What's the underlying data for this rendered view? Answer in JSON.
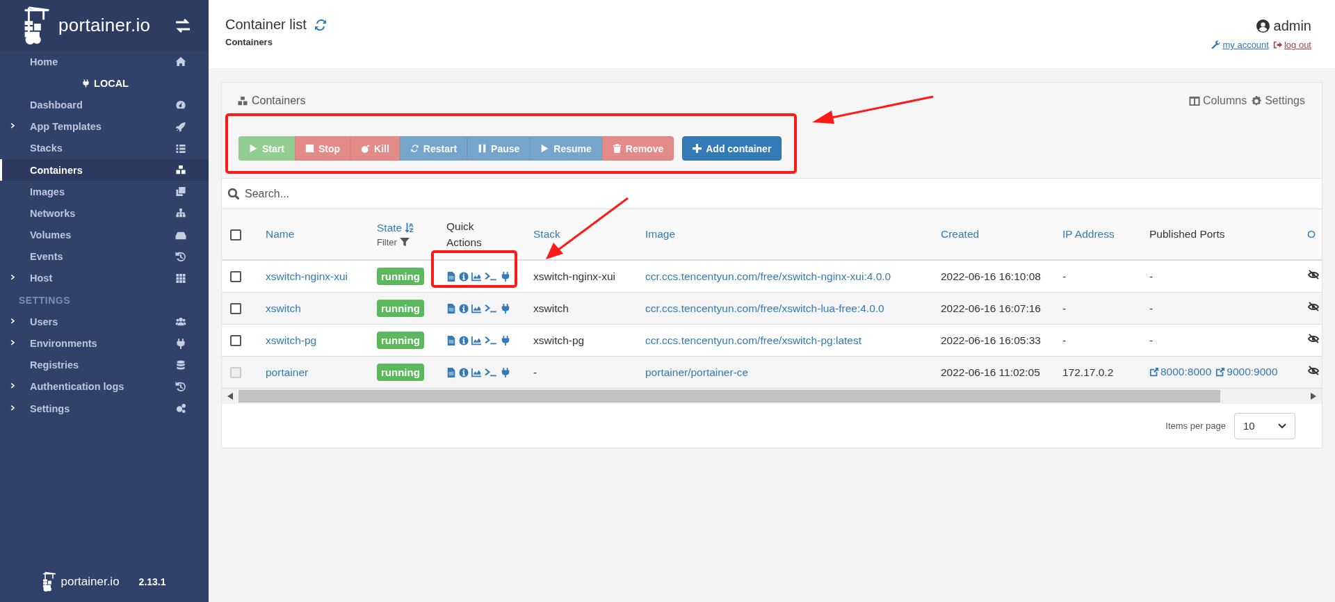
{
  "sidebar": {
    "logo_text": "portainer.io",
    "items": [
      {
        "label": "Home",
        "kind": "link",
        "expandable": false,
        "selected": false
      },
      {
        "label": "LOCAL",
        "kind": "environment",
        "selected": false
      },
      {
        "label": "Dashboard",
        "kind": "link",
        "expandable": false,
        "selected": false
      },
      {
        "label": "App Templates",
        "kind": "link",
        "expandable": true,
        "selected": false
      },
      {
        "label": "Stacks",
        "kind": "link",
        "expandable": false,
        "selected": false
      },
      {
        "label": "Containers",
        "kind": "link",
        "expandable": false,
        "selected": true
      },
      {
        "label": "Images",
        "kind": "link",
        "expandable": false,
        "selected": false
      },
      {
        "label": "Networks",
        "kind": "link",
        "expandable": false,
        "selected": false
      },
      {
        "label": "Volumes",
        "kind": "link",
        "expandable": false,
        "selected": false
      },
      {
        "label": "Events",
        "kind": "link",
        "expandable": false,
        "selected": false
      },
      {
        "label": "Host",
        "kind": "link",
        "expandable": true,
        "selected": false
      },
      {
        "label": "SETTINGS",
        "kind": "section",
        "selected": false
      },
      {
        "label": "Users",
        "kind": "link",
        "expandable": true,
        "selected": false
      },
      {
        "label": "Environments",
        "kind": "link",
        "expandable": true,
        "selected": false
      },
      {
        "label": "Registries",
        "kind": "link",
        "expandable": false,
        "selected": false
      },
      {
        "label": "Authentication logs",
        "kind": "link",
        "expandable": true,
        "selected": false
      },
      {
        "label": "Settings",
        "kind": "link",
        "expandable": true,
        "selected": false
      }
    ],
    "footer": {
      "logo_text": "portainer.io",
      "version": "2.13.1"
    }
  },
  "header": {
    "title": "Container list",
    "breadcrumb": "Containers",
    "user": "admin",
    "account_link": "my account",
    "logout_link": "log out"
  },
  "panel": {
    "title": "Containers",
    "tools": [
      "Columns",
      "Settings"
    ],
    "actions": [
      {
        "label": "Start",
        "kind": "success",
        "disabled": true
      },
      {
        "label": "Stop",
        "kind": "danger",
        "disabled": true
      },
      {
        "label": "Kill",
        "kind": "danger",
        "disabled": true
      },
      {
        "label": "Restart",
        "kind": "primary",
        "disabled": true
      },
      {
        "label": "Pause",
        "kind": "primary",
        "disabled": true
      },
      {
        "label": "Resume",
        "kind": "primary",
        "disabled": true
      },
      {
        "label": "Remove",
        "kind": "danger",
        "disabled": true
      }
    ],
    "add_button": "Add container",
    "search": {
      "placeholder": "Search..."
    },
    "table": {
      "all_selected": false,
      "columns": [
        {
          "label": "Name",
          "sortable": true
        },
        {
          "label": "State",
          "sortable": true,
          "filter": "Filter"
        },
        {
          "label": "Quick Actions",
          "sortable": false
        },
        {
          "label": "Stack",
          "sortable": true
        },
        {
          "label": "Image",
          "sortable": true
        },
        {
          "label": "Created",
          "sortable": true
        },
        {
          "label": "IP Address",
          "sortable": true
        },
        {
          "label": "Published Ports",
          "sortable": false
        },
        {
          "label": "O",
          "sortable": true
        }
      ],
      "rows": [
        {
          "checked": false,
          "disabled": false,
          "name": "xswitch-nginx-xui",
          "state": "running",
          "stack": "xswitch-nginx-xui",
          "image": "ccr.ccs.tencentyun.com/free/xswitch-nginx-xui:4.0.0",
          "created": "2022-06-16 16:10:08",
          "ip": "-",
          "ports": [
            {
              "label": "-",
              "kind": "text"
            }
          ]
        },
        {
          "checked": false,
          "disabled": false,
          "name": "xswitch",
          "state": "running",
          "stack": "xswitch",
          "image": "ccr.ccs.tencentyun.com/free/xswitch-lua-free:4.0.0",
          "created": "2022-06-16 16:07:16",
          "ip": "-",
          "ports": [
            {
              "label": "-",
              "kind": "text"
            }
          ]
        },
        {
          "checked": false,
          "disabled": false,
          "name": "xswitch-pg",
          "state": "running",
          "stack": "xswitch-pg",
          "image": "ccr.ccs.tencentyun.com/free/xswitch-pg:latest",
          "created": "2022-06-16 16:05:33",
          "ip": "-",
          "ports": [
            {
              "label": "-",
              "kind": "text"
            }
          ]
        },
        {
          "checked": false,
          "disabled": true,
          "name": "portainer",
          "state": "running",
          "stack": "-",
          "image": "portainer/portainer-ce",
          "created": "2022-06-16 11:02:05",
          "ip": "172.17.0.2",
          "ports": [
            {
              "label": "8000:8000",
              "kind": "link"
            },
            {
              "label": "9000:9000",
              "kind": "link"
            }
          ]
        }
      ]
    },
    "pagination": {
      "label": "Items per page",
      "value": "10"
    }
  }
}
